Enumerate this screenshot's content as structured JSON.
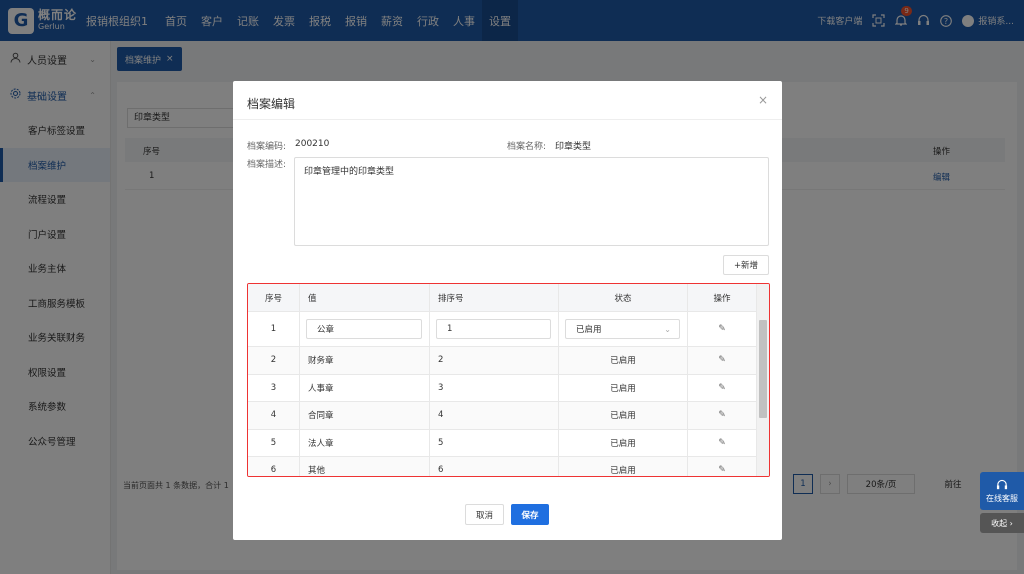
{
  "header": {
    "logo_mark": "G",
    "logo_cn": "概而论",
    "logo_en": "Gerlun",
    "org": "报销根组织1",
    "nav": [
      "首页",
      "客户",
      "记账",
      "发票",
      "报税",
      "报销",
      "薪资",
      "行政",
      "人事",
      "设置"
    ],
    "active_nav": "设置",
    "download": "下载客户端",
    "notif_count": "9",
    "user": "报销系..."
  },
  "sidebar": {
    "group1": "人员设置",
    "group2": "基础设置",
    "items": [
      "客户标签设置",
      "档案维护",
      "流程设置",
      "门户设置",
      "业务主体",
      "工商服务模板",
      "业务关联财务",
      "权限设置",
      "系统参数",
      "公众号管理"
    ],
    "active": "档案维护"
  },
  "tab": {
    "label": "档案维护",
    "close": "×"
  },
  "background": {
    "search_value": "印章类型",
    "col_index": "序号",
    "col_op": "操作",
    "row_index": "1",
    "row_op": "编辑",
    "footer_text": "当前页面共 1 条数据，合计 1",
    "page": "1",
    "next": "›",
    "page_size": "20条/页",
    "goto": "前往"
  },
  "float": {
    "chat": "在线客服",
    "collapse": "收起 ›"
  },
  "modal": {
    "title": "档案编辑",
    "close": "×",
    "code_label": "档案编码:",
    "code_value": "200210",
    "name_label": "档案名称:",
    "name_value": "印章类型",
    "desc_label": "档案描述:",
    "desc_value": "印章管理中的印章类型",
    "add_button": "+新增",
    "table": {
      "headers": [
        "序号",
        "值",
        "排序号",
        "状态",
        "操作"
      ],
      "editing_row": {
        "index": "1",
        "value": "公章",
        "sort": "1",
        "status": "已启用"
      },
      "rows": [
        {
          "index": "2",
          "value": "财务章",
          "sort": "2",
          "status": "已启用"
        },
        {
          "index": "3",
          "value": "人事章",
          "sort": "3",
          "status": "已启用"
        },
        {
          "index": "4",
          "value": "合同章",
          "sort": "4",
          "status": "已启用"
        },
        {
          "index": "5",
          "value": "法人章",
          "sort": "5",
          "status": "已启用"
        },
        {
          "index": "6",
          "value": "其他",
          "sort": "6",
          "status": "已启用"
        }
      ]
    },
    "cancel": "取消",
    "save": "保存"
  },
  "colors": {
    "primary": "#1f5aa8",
    "save": "#1f6fe0",
    "highlight_border": "#e33333",
    "badge": "#f5532d"
  }
}
